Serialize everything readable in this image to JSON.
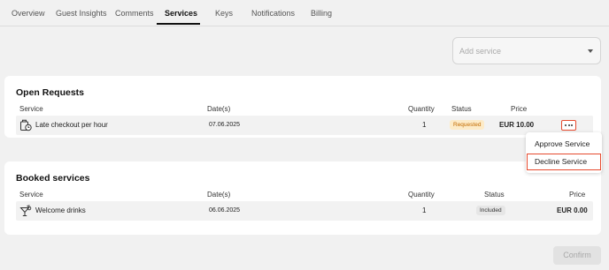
{
  "tabs": [
    "Overview",
    "Guest Insights",
    "Comments",
    "Services",
    "Keys",
    "Notifications",
    "Billing"
  ],
  "active_tab": "Services",
  "add_service": {
    "placeholder": "Add service"
  },
  "open_requests": {
    "title": "Open Requests",
    "headers": {
      "service": "Service",
      "dates": "Date(s)",
      "quantity": "Quantity",
      "status": "Status",
      "price": "Price"
    },
    "rows": [
      {
        "service": "Late checkout per hour",
        "date": "07.06.2025",
        "quantity": "1",
        "status": "Requested",
        "price": "EUR 10.00",
        "icon": "luggage-clock-icon"
      }
    ]
  },
  "row_menu": {
    "items": [
      "Approve Service",
      "Decline Service"
    ],
    "highlighted": "Decline Service"
  },
  "booked_services": {
    "title": "Booked services",
    "headers": {
      "service": "Service",
      "dates": "Date(s)",
      "quantity": "Quantity",
      "status": "Status",
      "price": "Price"
    },
    "rows": [
      {
        "service": "Welcome drinks",
        "date": "06.06.2025",
        "quantity": "1",
        "status": "Included",
        "price": "EUR 0.00",
        "icon": "cocktail-icon"
      }
    ]
  },
  "confirm_label": "Confirm",
  "colors": {
    "accent_outline": "#e64a2e",
    "requested_bg": "#fdebc8",
    "requested_text": "#c26a00",
    "included_bg": "#e6e6e6"
  }
}
